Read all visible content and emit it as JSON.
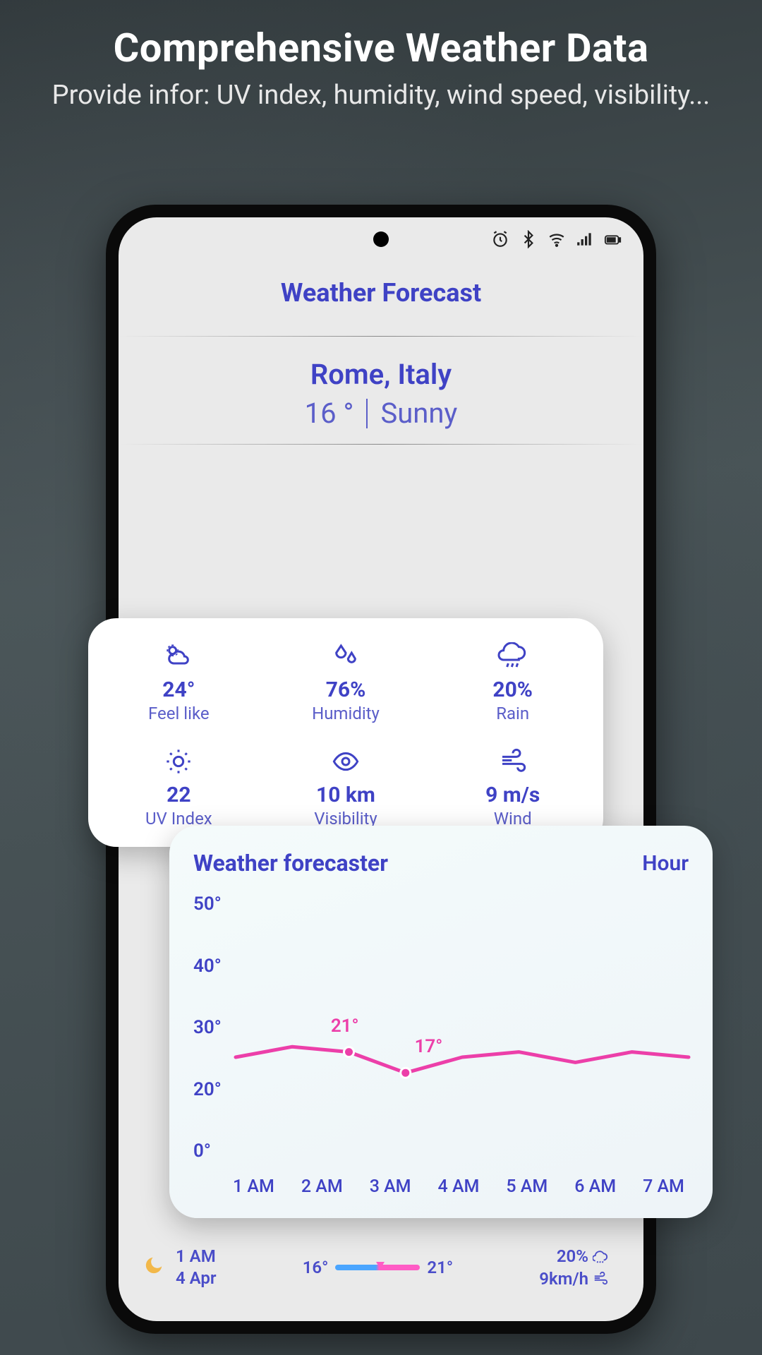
{
  "promo": {
    "title": "Comprehensive Weather Data",
    "subtitle": "Provide infor: UV index, humidity, wind speed, visibility..."
  },
  "status_icons": [
    "alarm",
    "bluetooth",
    "wifi",
    "signal",
    "battery"
  ],
  "app": {
    "title": "Weather Forecast",
    "location": "Rome, Italy",
    "temp": "16 °",
    "condition": "Sunny"
  },
  "metrics": [
    {
      "icon": "cloud-sun",
      "value": "24°",
      "label": "Feel like"
    },
    {
      "icon": "droplets",
      "value": "76%",
      "label": "Humidity"
    },
    {
      "icon": "cloud-rain",
      "value": "20%",
      "label": "Rain"
    },
    {
      "icon": "sun",
      "value": "22",
      "label": "UV Index"
    },
    {
      "icon": "eye",
      "value": "10 km",
      "label": "Visibility"
    },
    {
      "icon": "wind",
      "value": "9 m/s",
      "label": "Wind"
    }
  ],
  "secondary_values": [
    "22",
    "10 km",
    "9 m/s"
  ],
  "chart": {
    "title": "Weather forecaster",
    "mode": "Hour",
    "annot_hi": "21°",
    "annot_lo": "17°"
  },
  "chart_data": {
    "type": "line",
    "xlabel": "",
    "ylabel": "",
    "ylim": [
      0,
      50
    ],
    "y_ticks": [
      "50°",
      "40°",
      "30°",
      "20°",
      "0°"
    ],
    "categories": [
      "1 AM",
      "2 AM",
      "3 AM",
      "4 AM",
      "5 AM",
      "6 AM",
      "7 AM"
    ],
    "values": [
      20,
      22,
      21,
      17,
      20,
      21,
      19,
      21,
      20
    ],
    "annotations": [
      {
        "hour": "3 AM",
        "value": 21,
        "label": "21°"
      },
      {
        "hour": "3 AM_after",
        "value": 17,
        "label": "17°"
      }
    ]
  },
  "hourly_strip": {
    "time": "1 AM",
    "date": "4 Apr",
    "low": "16°",
    "high": "21°",
    "rain": "20%",
    "wind": "9km/h"
  }
}
